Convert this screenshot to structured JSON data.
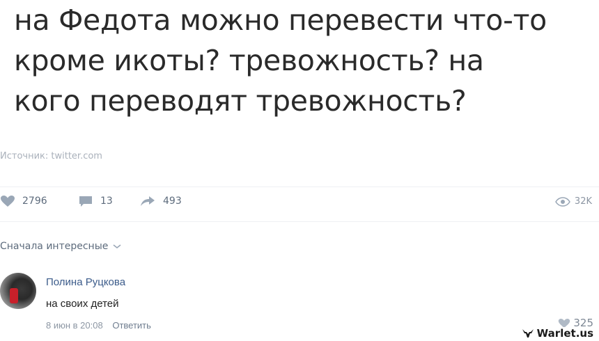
{
  "post": {
    "lines": [
      "на Федота можно перевести что-то",
      "кроме икоты? тревожность? на",
      "кого переводят тревожность?"
    ],
    "source": "Источник: twitter.com"
  },
  "actions": {
    "likes": "2796",
    "comments": "13",
    "reposts": "493",
    "views": "32K"
  },
  "sort": {
    "label": "Сначала интересные"
  },
  "comment": {
    "author": "Полина Руцкова",
    "text": "на своих детей",
    "date": "8 июн в 20:08",
    "reply": "Ответить",
    "likes": "325"
  },
  "watermark": {
    "text": "Warlet.us"
  },
  "colors": {
    "accent": "#3b5b8a",
    "icon": "#7d8da3"
  }
}
